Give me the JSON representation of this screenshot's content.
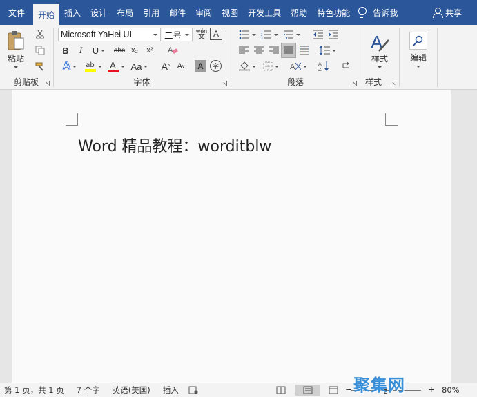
{
  "tabs": [
    {
      "label": "文件",
      "active": false
    },
    {
      "label": "开始",
      "active": true
    },
    {
      "label": "插入",
      "active": false
    },
    {
      "label": "设计",
      "active": false
    },
    {
      "label": "布局",
      "active": false
    },
    {
      "label": "引用",
      "active": false
    },
    {
      "label": "邮件",
      "active": false
    },
    {
      "label": "审阅",
      "active": false
    },
    {
      "label": "视图",
      "active": false
    },
    {
      "label": "开发工具",
      "active": false
    },
    {
      "label": "帮助",
      "active": false
    },
    {
      "label": "特色功能",
      "active": false
    }
  ],
  "tell_me": "告诉我",
  "share": "共享",
  "clipboard": {
    "label": "剪贴板",
    "paste_label": "粘贴"
  },
  "font": {
    "label": "字体",
    "font_name": "Microsoft YaHei UI",
    "font_size": "二号",
    "bold": "B",
    "italic": "I",
    "underline": "U",
    "strike": "abc",
    "subscript": "x₂",
    "superscript": "x²",
    "text_effects": "A",
    "highlight": "ab",
    "font_color": "A",
    "change_case": "Aa",
    "grow": "A",
    "shrink": "A",
    "char_shading": "A",
    "enclose": "字",
    "phonetic": "wén",
    "border_char": "A"
  },
  "paragraph": {
    "label": "段落"
  },
  "styles": {
    "label": "样式",
    "button": "样式"
  },
  "editing": {
    "label": "编辑",
    "button": "编辑"
  },
  "document": {
    "text": "Word 精品教程：worditblw"
  },
  "status": {
    "page": "第 1 页，共 1 页",
    "words": "7 个字",
    "language": "英语(美国)",
    "mode": "插入",
    "zoom_minus": "−",
    "zoom_plus": "+",
    "zoom": "80%"
  },
  "watermark": "聚集网",
  "colors": {
    "accent": "#2b579a",
    "highlight_yellow": "#ffff00",
    "font_red": "#e81123"
  }
}
